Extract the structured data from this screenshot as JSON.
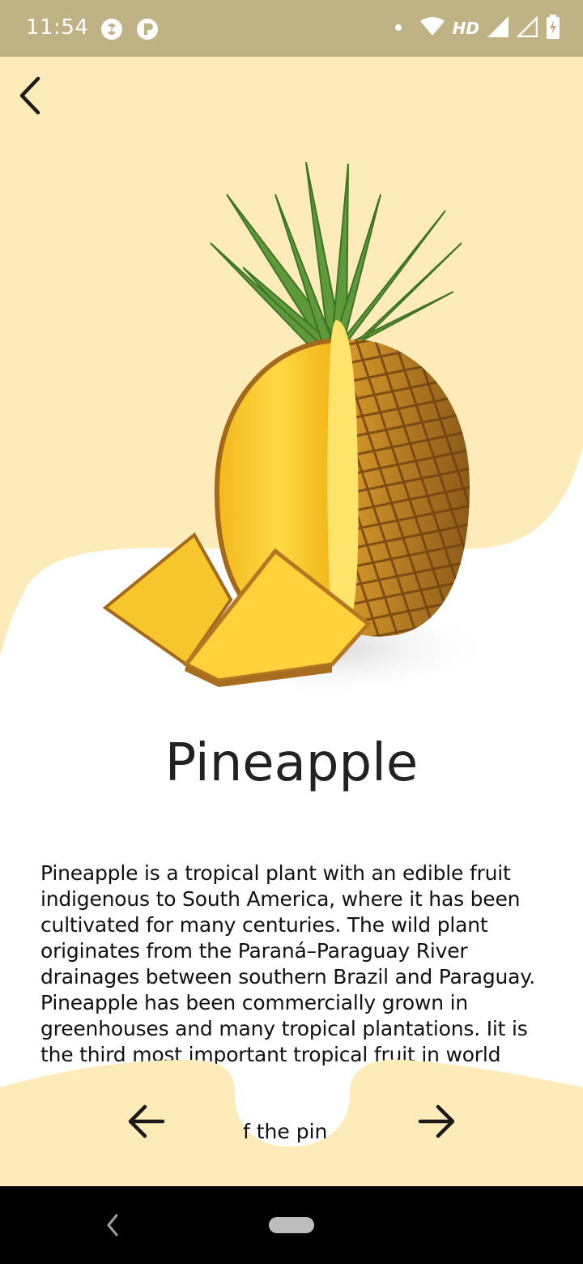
{
  "status_bar": {
    "time": "11:54",
    "app_icons": [
      "swirl-app-icon",
      "p-app-icon"
    ],
    "network_label": "HD",
    "icons": [
      "dot-icon",
      "wifi-icon",
      "signal-icon",
      "signal-empty-icon",
      "battery-charging-icon"
    ]
  },
  "colors": {
    "status_bar": "#bfb285",
    "accent_yellow": "#fdecb9",
    "background": "#ffffff",
    "title": "#222222"
  },
  "fruit": {
    "name": "Pineapple",
    "image_icon": "pineapple-image",
    "description": "Pineapple is a tropical plant with an edible fruit indigenous to South America, where it has been cultivated for many centuries. The wild plant originates from the Paraná–Paraguay River drainages between southern Brazil and Paraguay. Pineapple has been commercially grown in greenhouses and many tropical plantations. Iit is the third most important tropical fruit in world",
    "description_peek": "f the pin"
  },
  "navigation": {
    "back_icon": "chevron-left-icon",
    "prev_icon": "arrow-left-icon",
    "next_icon": "arrow-right-icon"
  },
  "system_nav": {
    "back_icon": "system-back-icon",
    "home_icon": "home-pill-icon"
  }
}
